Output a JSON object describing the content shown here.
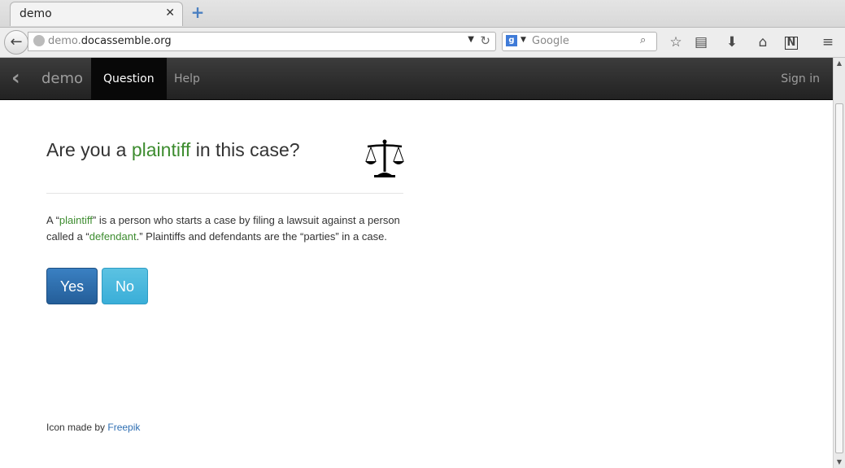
{
  "browser": {
    "tab_title": "demo",
    "tab_close": "✕",
    "new_tab": "+",
    "url_prefix": "demo.",
    "url_host": "docassemble.org",
    "search_placeholder": "Google",
    "search_engine_icon": "g"
  },
  "site": {
    "brand": "demo",
    "tabs": [
      {
        "label": "Question",
        "active": true
      },
      {
        "label": "Help",
        "active": false
      }
    ],
    "sign_in": "Sign in"
  },
  "question": {
    "pre": "Are you a ",
    "term": "plaintiff",
    "post": " in this case?"
  },
  "description": {
    "p1": "A “",
    "t1": "plaintiff",
    "p2": "” is a person who starts a case by filing a lawsuit against a person called a “",
    "t2": "defendant",
    "p3": ".” Plaintiffs and defendants are the “parties” in a case."
  },
  "buttons": {
    "yes": "Yes",
    "no": "No"
  },
  "footer": {
    "text": "Icon made by ",
    "link": "Freepik"
  },
  "colors": {
    "accent_green": "#3d8c2f",
    "yes_button": "#2a6aa8",
    "no_button": "#4ab8de",
    "navbar": "#222222"
  }
}
